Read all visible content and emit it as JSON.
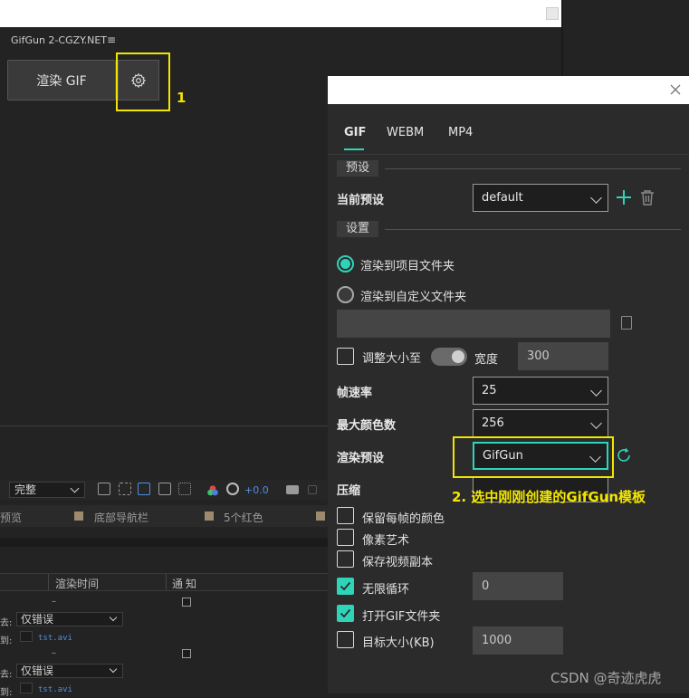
{
  "panel": {
    "title": "GifGun 2-CGZY.NET",
    "render_button": "渲染 GIF",
    "step1_label": "1"
  },
  "timeline": {
    "quality": "完整",
    "exposure": "+0.0",
    "preview": "预览",
    "bottom_nav": "底部导航栏",
    "red": "5个红色"
  },
  "queue": {
    "col_render_time": "渲染时间",
    "col_notify": "通知",
    "rows": [
      {
        "dash": "–",
        "label_a": "去:",
        "select": "仅错误",
        "label_b": "到:",
        "file": "tst.avi"
      },
      {
        "dash": "–",
        "label_a": "去:",
        "select": "仅错误",
        "label_b": "到:",
        "file": "tst.avi"
      }
    ]
  },
  "dialog": {
    "tabs": [
      {
        "label": "GIF"
      },
      {
        "label": "WEBM"
      },
      {
        "label": "MP4"
      }
    ],
    "section_preset": "预设",
    "current_preset_label": "当前预设",
    "current_preset_value": "default",
    "section_settings": "设置",
    "radio_project": "渲染到项目文件夹",
    "radio_custom": "渲染到自定义文件夹",
    "resize_label": "调整大小至",
    "width_label": "宽度",
    "width_value": "300",
    "framerate_label": "帧速率",
    "framerate_value": "25",
    "maxcolors_label": "最大颜色数",
    "maxcolors_value": "256",
    "render_preset_label": "渲染预设",
    "render_preset_value": "GifGun",
    "compress_label": "压缩",
    "annotation2": "2. 选中刚刚创建的GifGun模板",
    "opt_keep_colors": "保留每帧的颜色",
    "opt_pixel_art": "像素艺术",
    "opt_save_video": "保存视频副本",
    "opt_loop": "无限循环",
    "loop_value": "0",
    "opt_open_folder": "打开GIF文件夹",
    "opt_target_size": "目标大小(KB)",
    "target_size_value": "1000"
  },
  "watermark": "CSDN @奇迹虎虎",
  "colors": {
    "accent": "#2fd4b8",
    "annotation": "#f2e600"
  }
}
